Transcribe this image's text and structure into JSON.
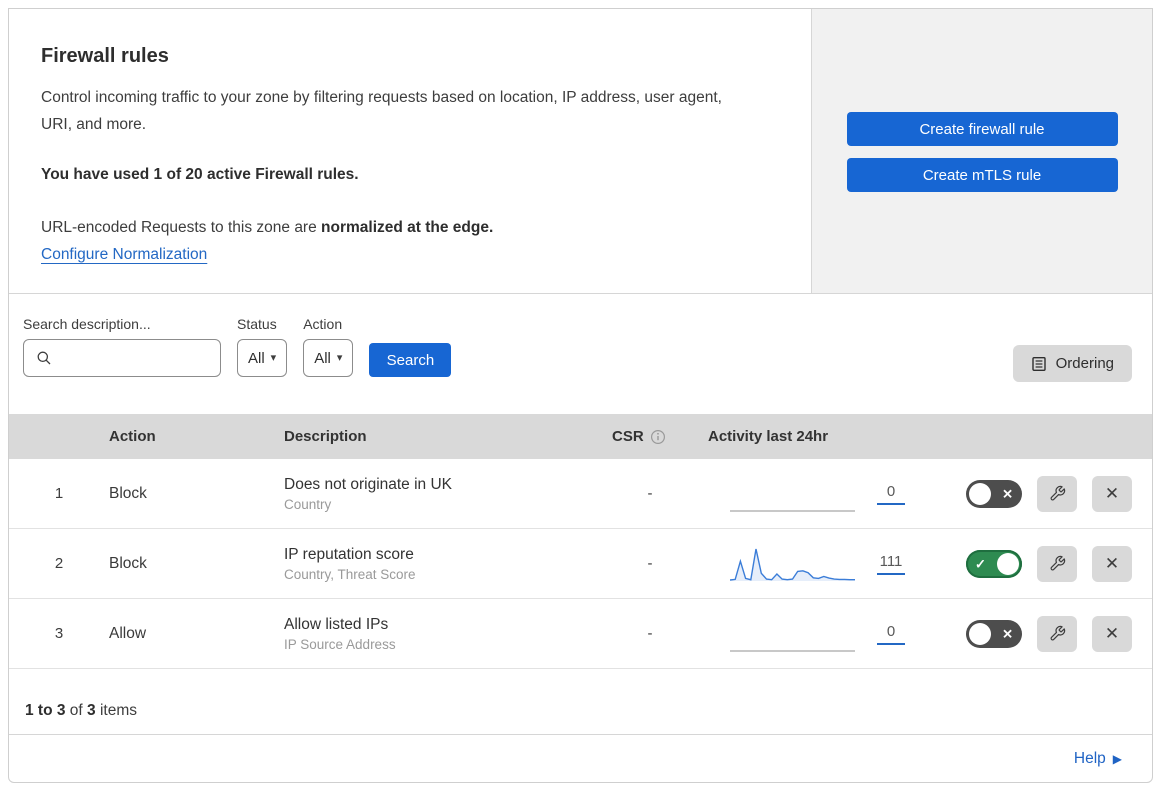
{
  "header": {
    "title": "Firewall rules",
    "description": "Control incoming traffic to your zone by filtering requests based on location, IP address, user agent, URI, and more.",
    "usage_note": "You have used 1 of 20 active Firewall rules.",
    "normalization_prefix": "URL-encoded Requests to this zone are ",
    "normalization_bold": "normalized at the edge.",
    "normalization_link": "Configure Normalization",
    "actions": {
      "create_firewall_rule": "Create firewall rule",
      "create_mtls_rule": "Create mTLS rule"
    }
  },
  "filters": {
    "search_label": "Search description...",
    "search_value": "",
    "status_label": "Status",
    "status_value": "All",
    "action_label": "Action",
    "action_value": "All",
    "search_button": "Search",
    "ordering_button": "Ordering"
  },
  "table": {
    "columns": {
      "action": "Action",
      "description": "Description",
      "csr": "CSR",
      "activity": "Activity last 24hr"
    },
    "rows": [
      {
        "priority": "1",
        "action": "Block",
        "description": "Does not originate in UK",
        "criteria": "Country",
        "csr": "-",
        "activity_count": "0",
        "enabled": false,
        "sparkline": []
      },
      {
        "priority": "2",
        "action": "Block",
        "description": "IP reputation score",
        "criteria": "Country, Threat Score",
        "csr": "-",
        "activity_count": "111",
        "enabled": true,
        "sparkline": [
          3,
          5,
          62,
          8,
          4,
          100,
          24,
          6,
          4,
          22,
          6,
          4,
          6,
          30,
          32,
          26,
          10,
          8,
          14,
          9,
          6,
          5,
          5,
          4,
          4
        ]
      },
      {
        "priority": "3",
        "action": "Allow",
        "description": "Allow listed IPs",
        "criteria": "IP Source Address",
        "csr": "-",
        "activity_count": "0",
        "enabled": false,
        "sparkline": []
      }
    ],
    "summary": {
      "range": "1 to 3",
      "of": " of ",
      "total": "3",
      "items": " items"
    }
  },
  "footer": {
    "help": "Help"
  },
  "colors": {
    "primary_blue": "#1766d3",
    "link_blue": "#2368c4",
    "toggle_on_green": "#2e8b51",
    "toggle_off_gray": "#4d4d4d",
    "sparkline_blue": "#3b7dd8"
  },
  "icons": {
    "toggle_on": "✓",
    "toggle_off": "✕",
    "close": "✕",
    "dropdown_caret": "▾",
    "help_arrow": "▶",
    "info": "i"
  }
}
